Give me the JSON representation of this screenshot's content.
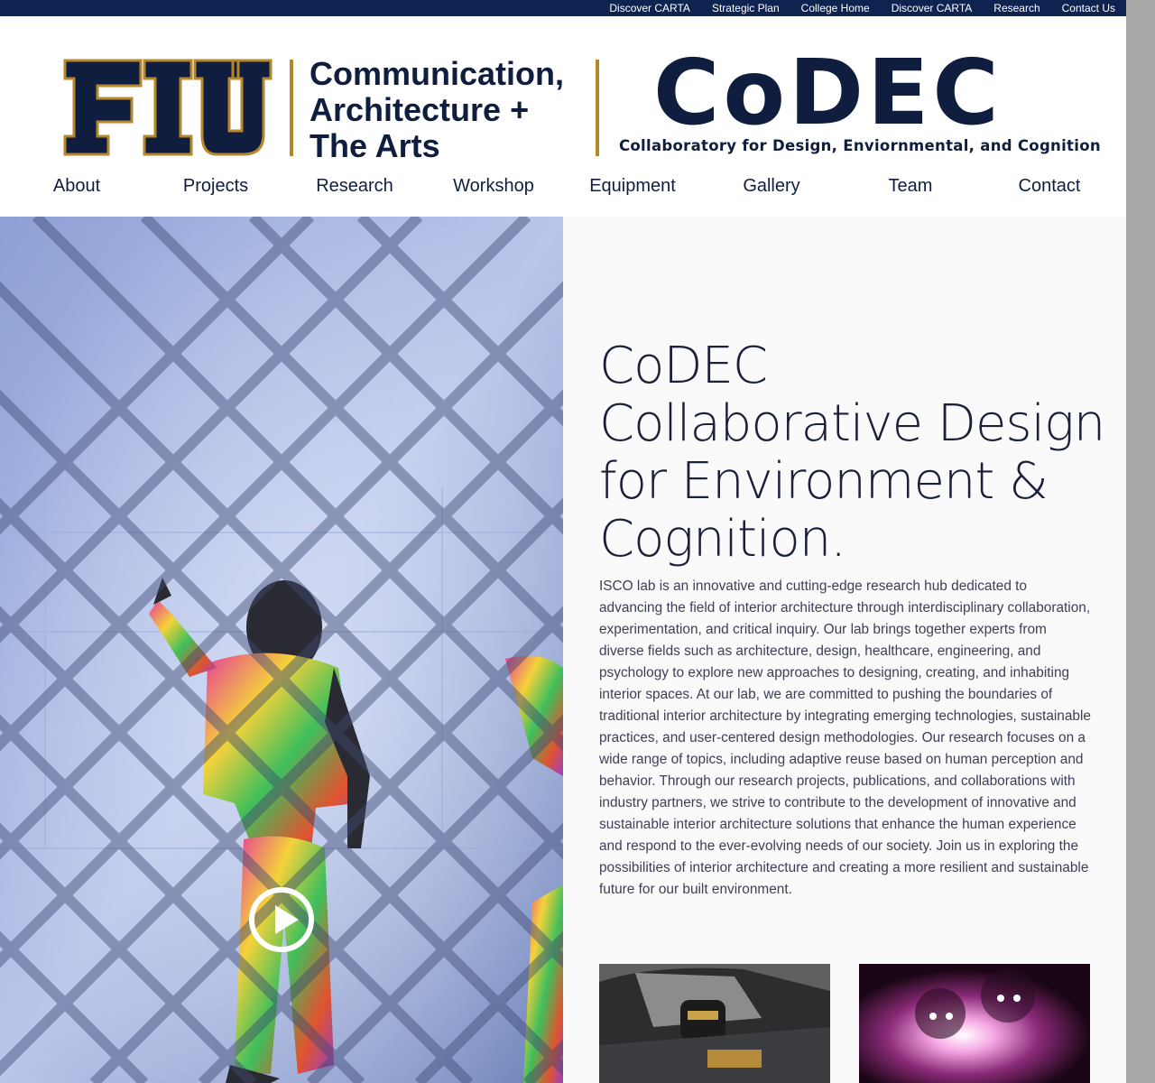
{
  "topbar": {
    "links": [
      "Discover CARTA",
      "Strategic Plan",
      "College Home",
      "Discover CARTA",
      "Research",
      "Contact Us"
    ]
  },
  "logo": {
    "fiu_text": "FIU",
    "college_lines": [
      "Communication,",
      "Architecture +",
      "The Arts"
    ],
    "codec_title": "CoDEC",
    "codec_subtitle": "Collaboratory for Design, Enviornmental, and Cognition"
  },
  "nav": {
    "items": [
      "About",
      "Projects",
      "Research",
      "Workshop",
      "Equipment",
      "Gallery",
      "Team",
      "Contact"
    ]
  },
  "main": {
    "headline_lines": [
      "CoDEC",
      "Collaborative Design",
      "for Environment &",
      "Cognition."
    ],
    "body": "ISCO lab is an innovative and cutting-edge research hub dedicated to advancing the field of interior architecture through interdisciplinary collaboration, experimentation, and critical inquiry. Our lab brings together experts from diverse fields such as architecture, design, healthcare, engineering, and psychology to explore new approaches to designing, creating, and inhabiting interior spaces. At our lab, we are committed to pushing the boundaries of traditional interior architecture by integrating emerging technologies, sustainable practices, and user-centered design methodologies. Our research focuses on a wide range of topics, including adaptive reuse based on human perception and behavior. Through our research projects, publications, and collaborations with industry partners, we strive to contribute to the development of innovative and sustainable interior architecture solutions that enhance the human experience and respond to the ever-evolving needs of our society. Join us in exploring the possibilities of interior architecture and creating a more resilient and sustainable future for our built environment."
  },
  "colors": {
    "navy": "#0f2350",
    "gold": "#b6862c",
    "text_dark": "#0f1d3e"
  },
  "icons": {
    "play": "play-circle-icon"
  }
}
